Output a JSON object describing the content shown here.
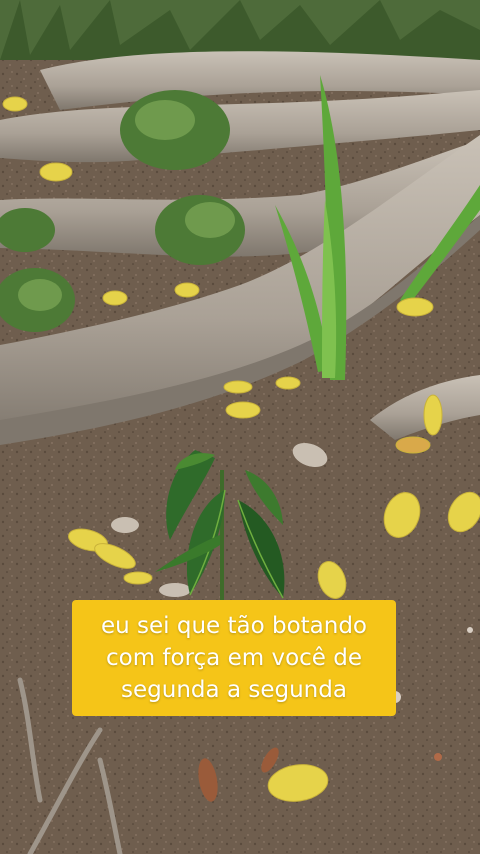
{
  "caption": {
    "lines": [
      "eu sei que tão botando",
      "com força em você de",
      "segunda a segunda"
    ],
    "background_color": "#f5c518",
    "text_color": "#ffffff"
  },
  "scene": {
    "subject": "mango-seedling",
    "palette": {
      "soil": "#6f5e4e",
      "root": "#b4aba0",
      "root_shadow": "#8d857b",
      "leaf_dark": "#2f6b2a",
      "leaf_light": "#6fae3f",
      "fallen_leaf": "#e6d34a"
    }
  }
}
